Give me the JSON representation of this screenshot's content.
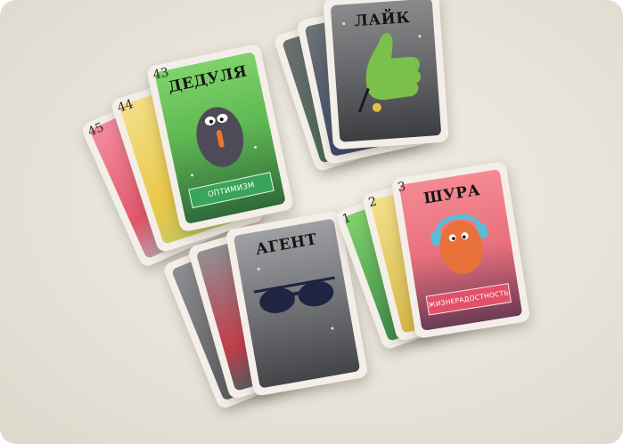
{
  "cards": {
    "dedulya": {
      "number": "43",
      "title": "ДЕДУЛЯ",
      "ribbon": "ОПТИМИЗМ"
    },
    "back44": {
      "number": "44"
    },
    "back45": {
      "number": "45"
    },
    "like": {
      "title": "ЛАЙК"
    },
    "agent": {
      "title": "АГЕНТ"
    },
    "shura": {
      "number": "3",
      "title": "ШУРА",
      "ribbon": "ЖИЗНЕРАДОСТНОСТЬ"
    },
    "back1": {
      "number": "1"
    },
    "back2": {
      "number": "2"
    }
  },
  "colors": {
    "background": "#e7e3d9",
    "green_card": "#6cc457",
    "gray_card": "#7a7a7c",
    "pink_card": "#f07b86",
    "yellow_card": "#f2d55c",
    "ribbon_green": "#3aa45a",
    "ribbon_pink": "#e2506a"
  },
  "icons": [
    "creature-icon",
    "thumbs-up-icon",
    "sunglasses-icon",
    "headphones-creature-icon"
  ]
}
